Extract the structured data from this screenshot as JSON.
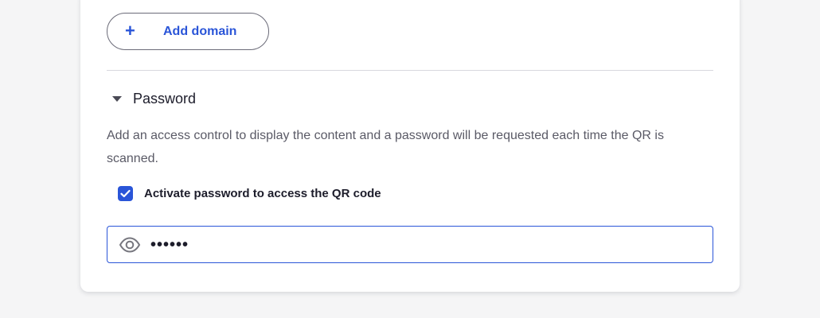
{
  "domains": {
    "add_button_icon": "+",
    "add_button_label": "Add domain"
  },
  "password_section": {
    "title": "Password",
    "expanded": true,
    "description": "Add an access control to display the content and a password will be requested each time the QR is scanned.",
    "checkbox": {
      "label": "Activate password to access the QR code",
      "checked": true
    },
    "field": {
      "value": "••••••",
      "icon": "eye-icon"
    }
  },
  "colors": {
    "accent": "#2a55d8",
    "background": "#f5f5f6",
    "card": "#ffffff",
    "text_primary": "#1d1d2b",
    "text_secondary": "#5a5a66",
    "divider": "#d8d8de"
  }
}
